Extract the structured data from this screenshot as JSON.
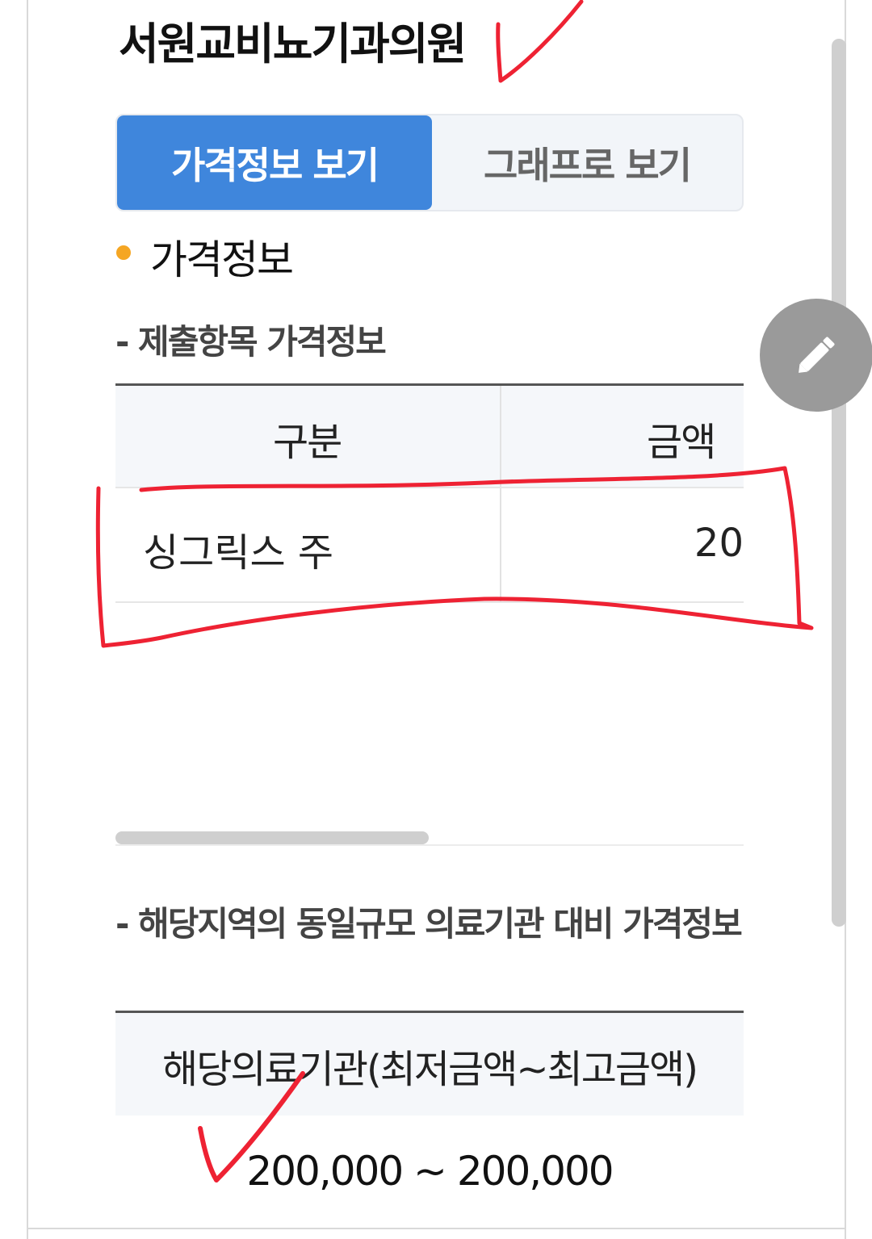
{
  "hospital_name": "서원교비뇨기과의원",
  "tabs": [
    {
      "label": "가격정보 보기",
      "active": true
    },
    {
      "label": "그래프로 보기",
      "active": false
    }
  ],
  "section": {
    "title": "가격정보",
    "dot_color": "#f5a623"
  },
  "price_table": {
    "subtitle": "- 제출항목 가격정보",
    "headers": [
      "구분",
      "금액"
    ],
    "rows": [
      {
        "item": "싱그릭스 주",
        "amount": "20"
      }
    ]
  },
  "regional_table": {
    "subtitle": "- 해당지역의 동일규모 의료기관 대비 가격정보",
    "header": "해당의료기관(최저금액~최고금액)",
    "range": "200,000 ~ 200,000"
  },
  "edit_button": {
    "icon": "pencil-icon"
  },
  "colors": {
    "accent": "#3f86dc",
    "annotation": "#ee2233",
    "fab": "#9a9a9a"
  }
}
